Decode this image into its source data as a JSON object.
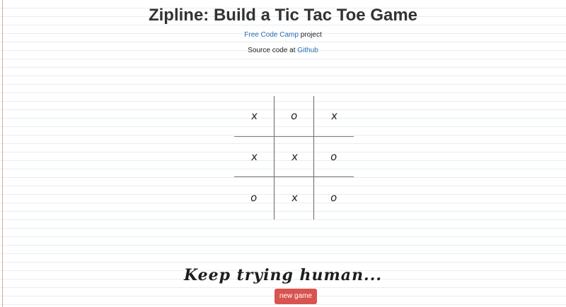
{
  "header": {
    "title": "Zipline: Build a Tic Tac Toe Game",
    "project_link": "Free Code Camp",
    "project_suffix": " project",
    "source_prefix": "Source code at ",
    "source_link": "Github"
  },
  "board": {
    "cells": [
      "x",
      "o",
      "x",
      "x",
      "x",
      "o",
      "o",
      "x",
      "o"
    ]
  },
  "status": {
    "message": "Keep trying human..."
  },
  "controls": {
    "new_game_label": "new game"
  },
  "colors": {
    "link": "#2b6cb0",
    "button": "#d9534f",
    "notebook_line": "#e6eef3",
    "margin_line": "#d7a79e"
  }
}
